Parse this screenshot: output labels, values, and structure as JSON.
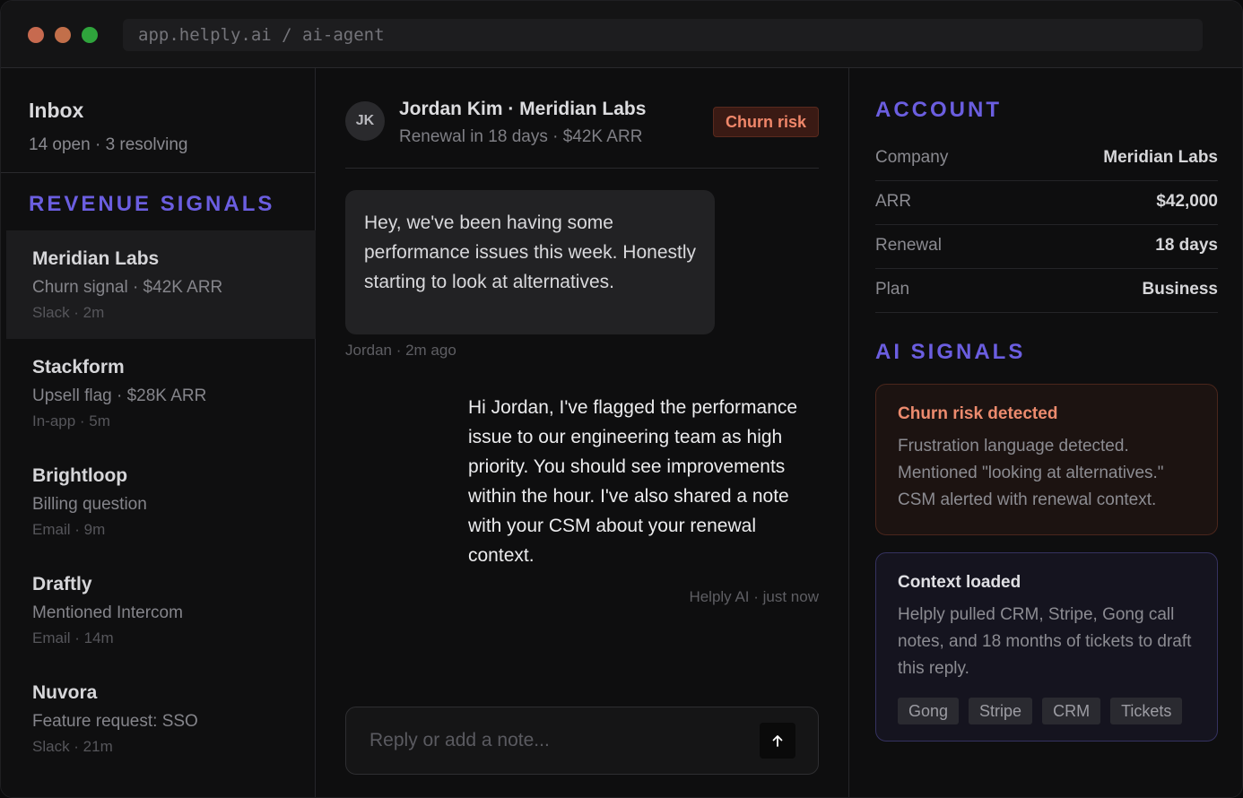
{
  "window": {
    "url": "app.helply.ai / ai-agent"
  },
  "sidebar": {
    "inbox_title": "Inbox",
    "inbox_subtitle": "14 open · 3 resolving",
    "section_label": "REVENUE SIGNALS",
    "items": [
      {
        "name": "Meridian Labs",
        "desc": "Churn signal · $42K ARR",
        "meta": "Slack · 2m",
        "active": true
      },
      {
        "name": "Stackform",
        "desc": "Upsell flag · $28K ARR",
        "meta": "In-app · 5m",
        "active": false
      },
      {
        "name": "Brightloop",
        "desc": "Billing question",
        "meta": "Email · 9m",
        "active": false
      },
      {
        "name": "Draftly",
        "desc": "Mentioned Intercom",
        "meta": "Email · 14m",
        "active": false
      },
      {
        "name": "Nuvora",
        "desc": "Feature request: SSO",
        "meta": "Slack · 21m",
        "active": false
      }
    ]
  },
  "conversation": {
    "avatar_initials": "JK",
    "contact_name": "Jordan Kim · Meridian Labs",
    "contact_subtitle": "Renewal in 18 days · $42K ARR",
    "badge": "Churn risk",
    "incoming_message": "Hey, we've been having some performance issues this week. Honestly starting to look at alternatives.",
    "incoming_meta": "Jordan · 2m ago",
    "outgoing_message": "Hi Jordan, I've flagged the performance issue to our engineering team as high priority. You should see improvements within the hour. I've also shared a note with your CSM about your renewal context.",
    "outgoing_meta": "Helply AI · just now",
    "reply_placeholder": "Reply or add a note...",
    "send_icon": "arrow-up-icon"
  },
  "account": {
    "section_label": "ACCOUNT",
    "rows": [
      {
        "key": "Company",
        "value": "Meridian Labs"
      },
      {
        "key": "ARR",
        "value": "$42,000"
      },
      {
        "key": "Renewal",
        "value": "18 days"
      },
      {
        "key": "Plan",
        "value": "Business"
      }
    ]
  },
  "ai_signals": {
    "section_label": "AI SIGNALS",
    "churn_card": {
      "title": "Churn risk detected",
      "body": "Frustration language detected. Mentioned \"looking at alternatives.\" CSM alerted with renewal context."
    },
    "context_card": {
      "title": "Context loaded",
      "body": "Helply pulled CRM, Stripe, Gong call notes, and 18 months of tickets to draft this reply.",
      "tags": [
        "Gong",
        "Stripe",
        "CRM",
        "Tickets"
      ]
    }
  },
  "colors": {
    "accent": "#6b5ee0",
    "churn": "#ec8b6e",
    "dot_red": "#c76a4f",
    "dot_yellow": "#c26f4a",
    "dot_green": "#2fa43c"
  }
}
